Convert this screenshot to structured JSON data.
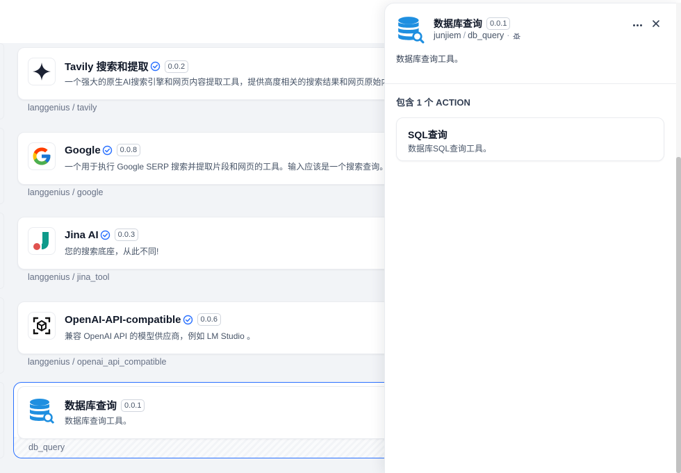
{
  "plugins": [
    {
      "name": "Tavily 搜索和提取",
      "version": "0.0.2",
      "verified": true,
      "description": "一个强大的原生AI搜索引擎和网页内容提取工具，提供高度相关的搜索结果和网页原始内容",
      "footer": "langgenius / tavily",
      "logo": "tavily-logo"
    },
    {
      "name": "Google",
      "version": "0.0.8",
      "verified": true,
      "description": "一个用于执行 Google SERP 搜索并提取片段和网页的工具。输入应该是一个搜索查询。",
      "footer": "langgenius / google",
      "logo": "google-logo"
    },
    {
      "name": "Jina AI",
      "version": "0.0.3",
      "verified": true,
      "description": "您的搜索底座，从此不同!",
      "footer": "langgenius / jina_tool",
      "logo": "jina-logo"
    },
    {
      "name": "OpenAI-API-compatible",
      "version": "0.0.6",
      "verified": true,
      "description": "兼容 OpenAI API 的模型供应商，例如 LM Studio 。",
      "footer": "langgenius / openai_api_compatible",
      "logo": "openai-compatible-logo"
    },
    {
      "name": "数据库查询",
      "version": "0.0.1",
      "verified": false,
      "description": "数据库查询工具。",
      "footer": "db_query",
      "logo": "database-logo"
    }
  ],
  "panel": {
    "title": "数据库查询",
    "version": "0.0.1",
    "author": "junjiem",
    "separator": "/",
    "plugin_id": "db_query",
    "dot": "·",
    "description": "数据库查询工具。",
    "section_title": "包含 1 个 ACTION",
    "actions": [
      {
        "name": "SQL查询",
        "description": "数据库SQL查询工具。"
      }
    ]
  },
  "colors": {
    "accent": "#2970ff",
    "db_blue": "#1f8fe0"
  }
}
